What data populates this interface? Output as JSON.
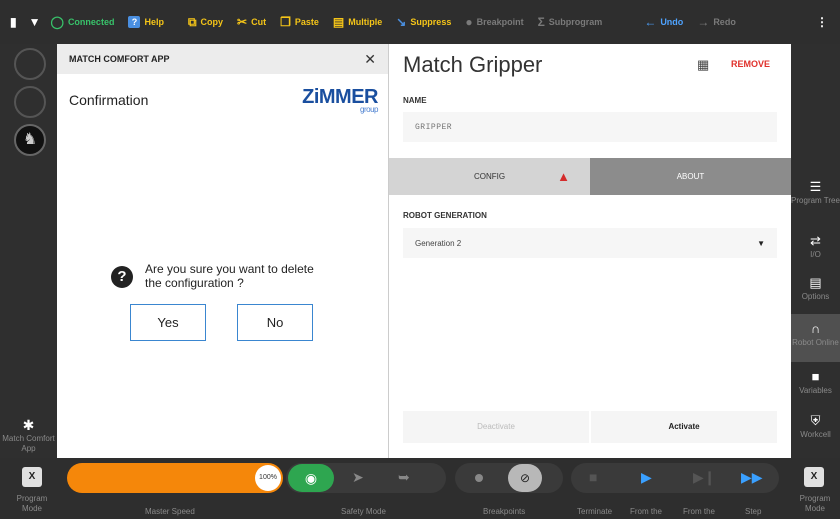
{
  "topbar": {
    "connected": "Connected",
    "help": "Help",
    "copy": "Copy",
    "cut": "Cut",
    "paste": "Paste",
    "multiple": "Multiple",
    "suppress": "Suppress",
    "breakpoint": "Breakpoint",
    "subprogram": "Subprogram",
    "undo": "Undo",
    "redo": "Redo"
  },
  "left_sidebar": {
    "app_label": "Match Comfort App"
  },
  "dialog": {
    "header": "MATCH COMFORT APP",
    "title": "Confirmation",
    "logo_text": "ZiMMER",
    "logo_sub": "group",
    "question": "Are you sure you want to delete the configuration ?",
    "yes": "Yes",
    "no": "No"
  },
  "panel": {
    "title": "Match Gripper",
    "remove": "REMOVE",
    "name_label": "NAME",
    "name_placeholder": "GRIPPER",
    "tab_config": "CONFIG",
    "tab_about": "ABOUT",
    "robot_gen_label": "ROBOT GENERATION",
    "robot_gen_value": "Generation 2",
    "deactivate": "Deactivate",
    "activate": "Activate"
  },
  "right_sidebar": {
    "items": [
      "Program Tree",
      "I/O",
      "Options",
      "Robot Online",
      "Variables",
      "Workcell"
    ]
  },
  "bottombar": {
    "program_mode": "Program Mode",
    "mode_icon": "X",
    "master_speed_label": "Master Speed",
    "speed_value": "100%",
    "safety_label": "Safety Mode",
    "breakpoints_label": "Breakpoints",
    "terminate": "Terminate",
    "from_the_1": "From the",
    "from_the_2": "From the",
    "step": "Step"
  },
  "colors": {
    "accent_orange": "#f5870a",
    "connected_green": "#38c26a",
    "toolbar_yellow": "#f5c518",
    "remove_red": "#e0302b",
    "safety_green": "#2ea650",
    "button_border_blue": "#3a86d0"
  },
  "progress": {
    "master_speed_fraction": 1.0
  }
}
